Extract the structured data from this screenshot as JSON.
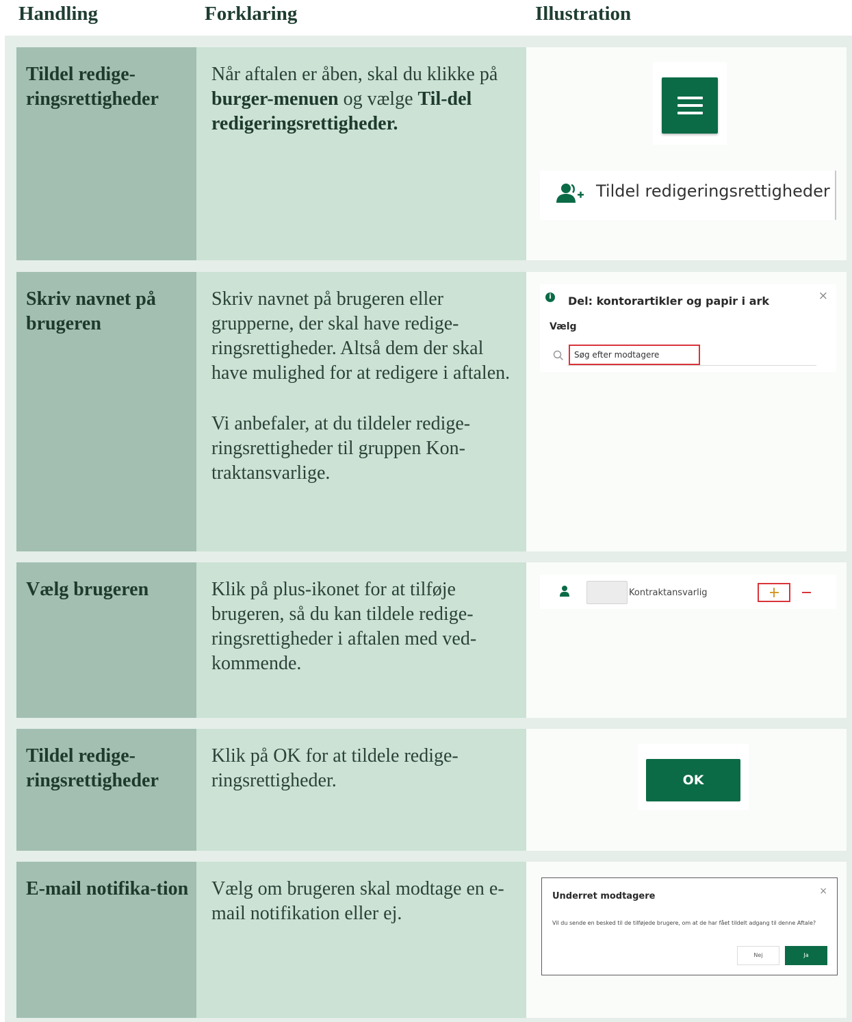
{
  "headers": {
    "handling": "Handling",
    "forklaring": "Forklaring",
    "illustration": "Illustration"
  },
  "rows": [
    {
      "action": "Tildel redige-ringsrettigheder",
      "explanation": {
        "t1": "Når aftalen er åben, skal du klikke på ",
        "b1": "burger-menuen",
        "t2": " og vælge ",
        "b2": "Til-del redigeringsrettigheder."
      },
      "menu_item_label": "Tildel redigeringsrettigheder",
      "icons": [
        "burger-menu-icon",
        "add-user-icon"
      ]
    },
    {
      "action": "Skriv navnet på brugeren",
      "explanation": {
        "p1": "Skriv navnet på brugeren eller grupperne, der skal have redige-ringsrettigheder. Altså dem der skal have mulighed for at redigere i aftalen.",
        "p2": "Vi anbefaler, at du tildeler redige-ringsrettigheder til gruppen Kon-traktansvarlige."
      },
      "dialog_title": "Del: kontorartikler og papir i ark",
      "select_label": "Vælg",
      "search_placeholder": "Søg efter modtagere",
      "close_glyph": "×"
    },
    {
      "action": "Vælg brugeren",
      "explanation": {
        "p1": "Klik på plus-ikonet for at tilføje brugeren, så du kan tildele redige-ringsrettigheder i aftalen med ved-kommende."
      },
      "user_name": "Kontraktansvarlig"
    },
    {
      "action": "Tildel redige-ringsrettigheder",
      "explanation": {
        "p1": "Klik på OK for at tildele redige-ringsrettigheder."
      },
      "ok_label": "OK"
    },
    {
      "action": "E-mail notifika-tion",
      "explanation": {
        "p1": "Vælg om brugeren skal modtage en e-mail notifikation eller ej."
      },
      "dialog_title": "Underret modtagere",
      "dialog_text": "Vil du sende en besked til de tilføjede brugere, om at de har fået tildelt adgang til denne Aftale?",
      "no_label": "Nej",
      "yes_label": "Ja",
      "close_glyph": "×"
    }
  ],
  "colors": {
    "brand_green": "#0b6b47",
    "col1_bg": "#a2bfb2",
    "col2_bg": "#cbe2d5",
    "frame_bg": "#e5eee8",
    "highlight_red": "#d9343a"
  }
}
